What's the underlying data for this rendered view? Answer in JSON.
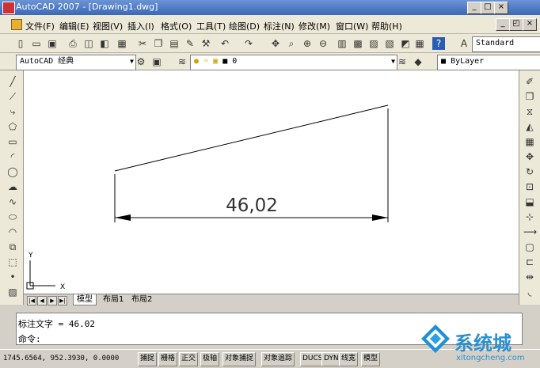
{
  "window": {
    "title": "AutoCAD 2007 - [Drawing1.dwg]"
  },
  "menu": [
    "文件(F)",
    "编辑(E)",
    "视图(V)",
    "插入(I)",
    "格式(O)",
    "工具(T)",
    "绘图(D)",
    "标注(N)",
    "修改(M)",
    "窗口(W)",
    "帮助(H)"
  ],
  "toolbar": {
    "text_style": "Standard",
    "workspace": "AutoCAD 经典",
    "layer": "0",
    "color": "ByLayer"
  },
  "drawing": {
    "dimension_text": "46,02"
  },
  "ucs": {
    "x_label": "X",
    "y_label": "Y"
  },
  "tabs": [
    "模型",
    "布局1",
    "布局2"
  ],
  "command": {
    "history": "标注文字 = 46.02",
    "prompt": "命令:"
  },
  "status": {
    "coords": "1745.6564, 952.3930, 0.0000",
    "buttons": [
      "捕捉",
      "栅格",
      "正交",
      "极轴",
      "对象捕捉",
      "对象追踪",
      "DUCS",
      "DYN",
      "线宽",
      "模型"
    ]
  },
  "watermark": {
    "text": "系统城",
    "url": "xitongcheng.com"
  }
}
